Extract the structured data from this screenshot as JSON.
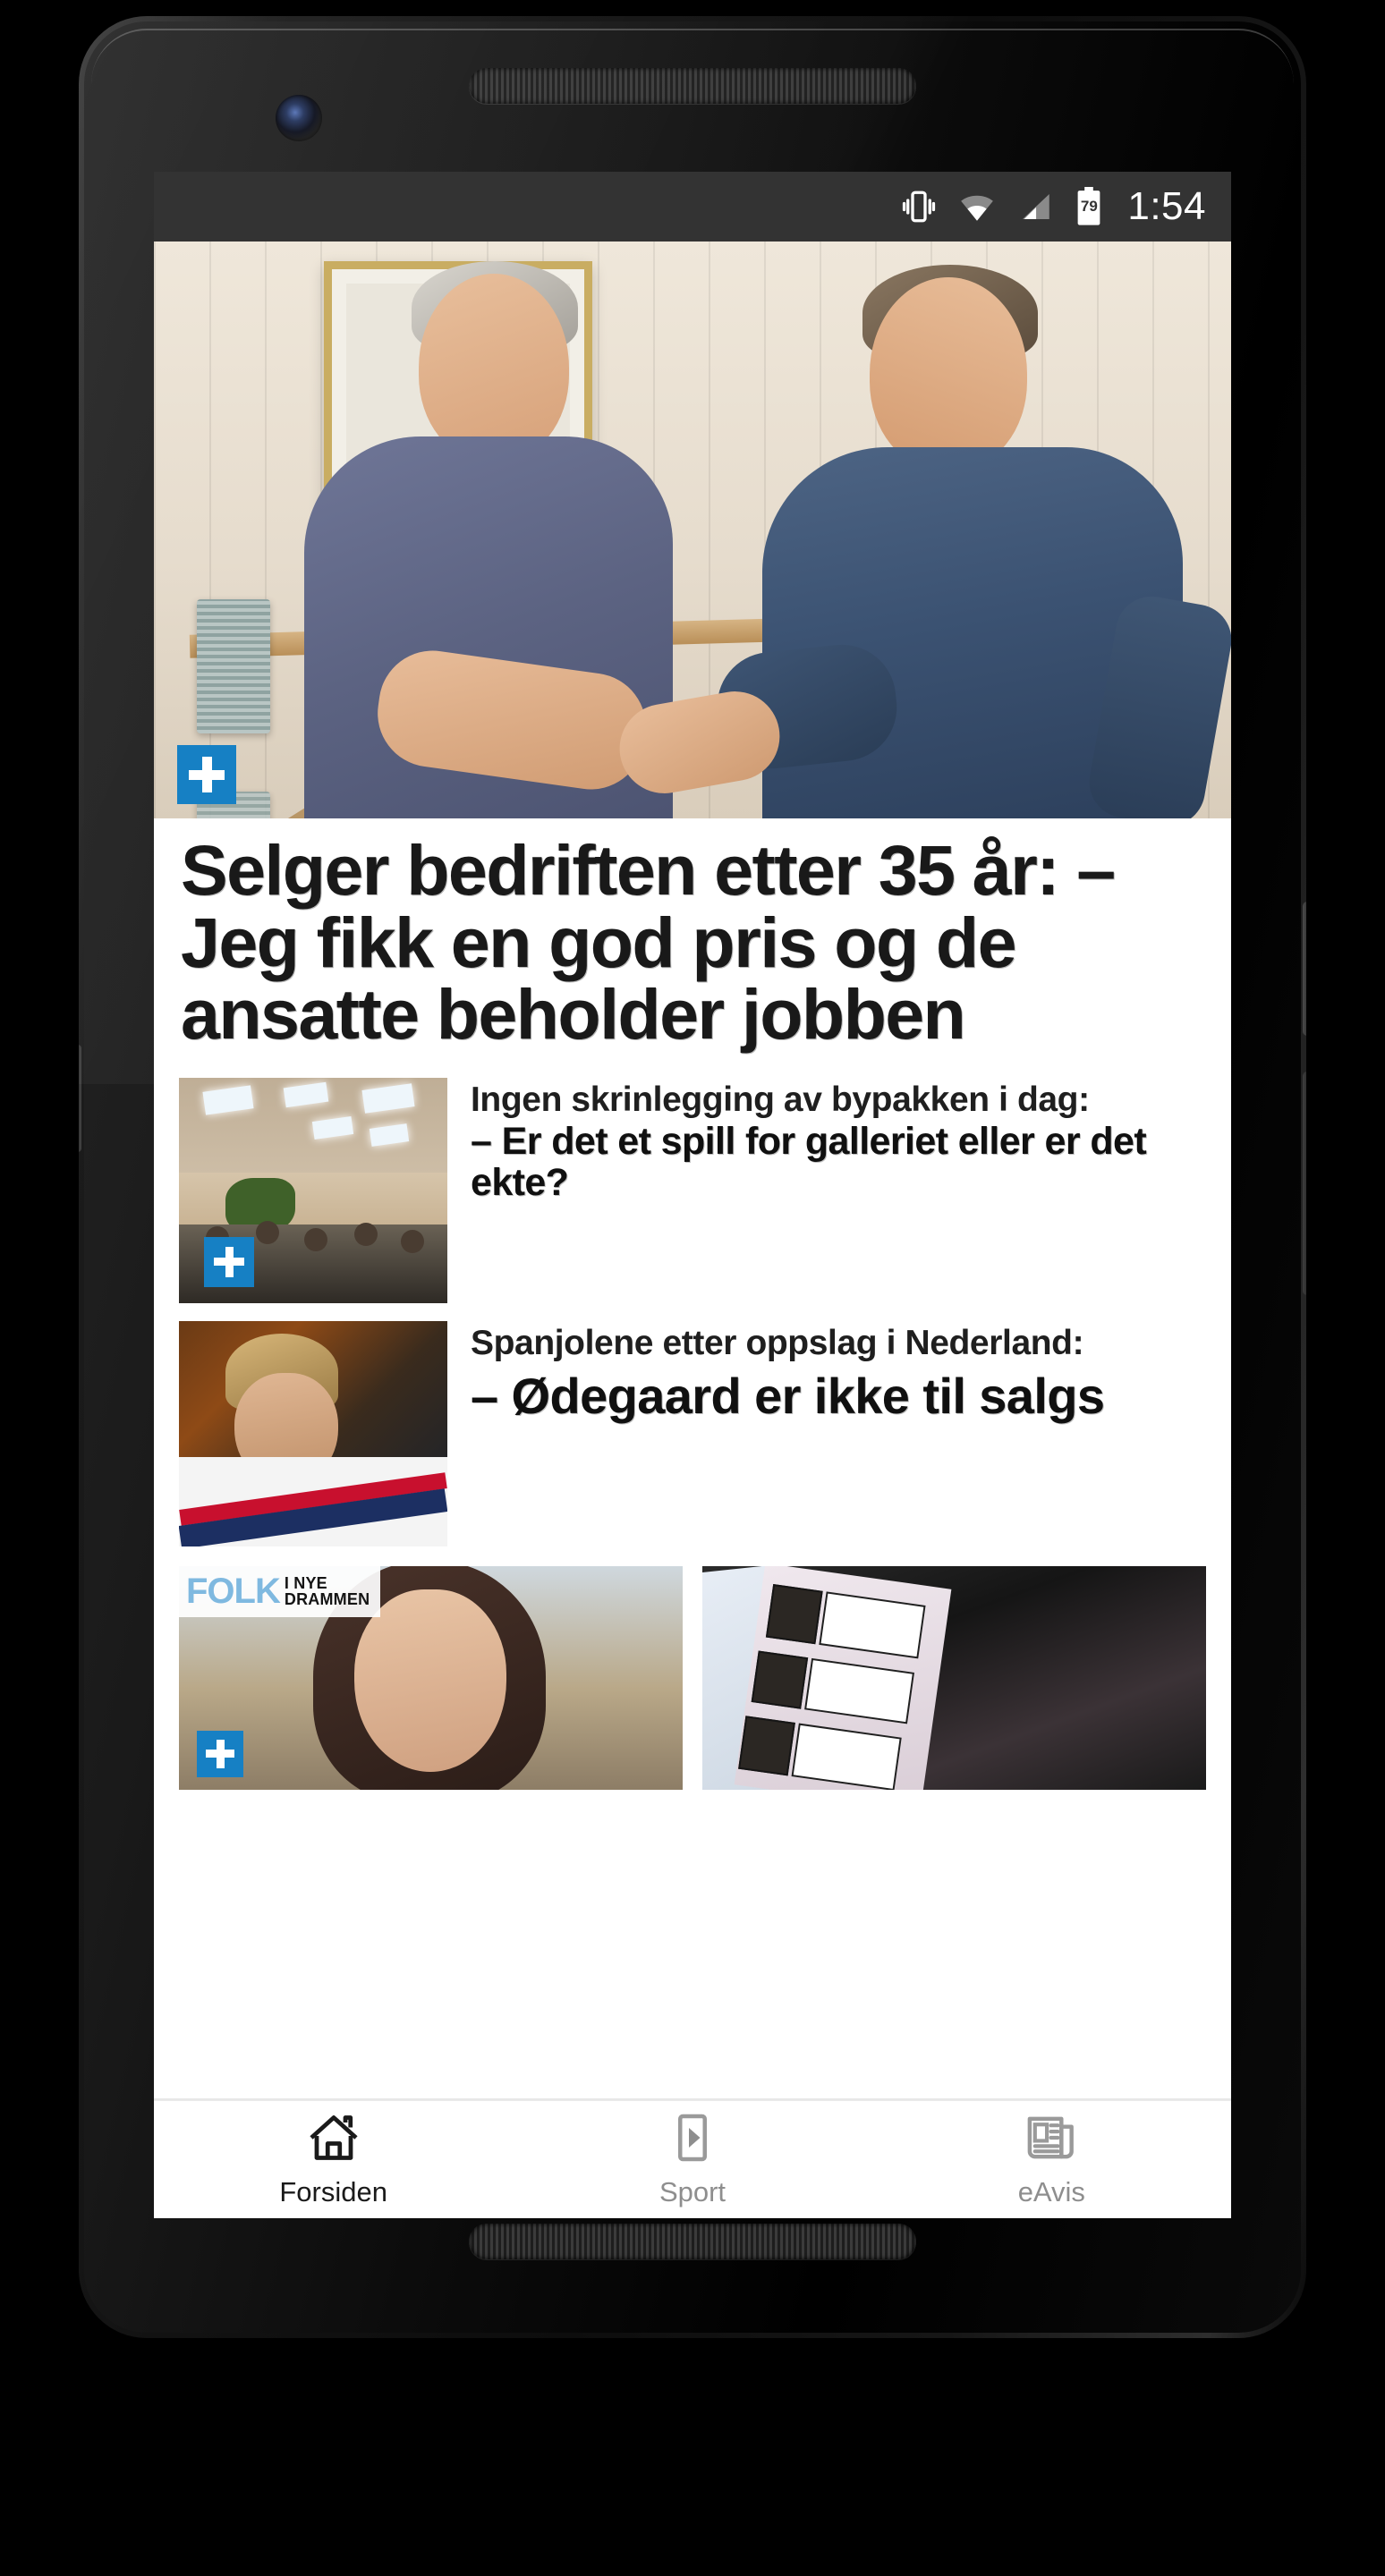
{
  "status_bar": {
    "time": "1:54",
    "battery_percent": "79",
    "icons": [
      "vibrate-icon",
      "wifi-icon",
      "signal-icon",
      "battery-icon"
    ]
  },
  "theme": {
    "plus_badge_blue": "#1680c4",
    "status_bar_bg": "#333333",
    "nav_active_color": "#1a1a1a",
    "nav_inactive_color": "#8e8e8e",
    "folk_brand_blue": "#7fb9e0"
  },
  "feed": {
    "hero": {
      "plus_badge": "+",
      "headline": "Selger bedriften etter 35 år: – Jeg fikk en god pris og de ansatte beholder jobben",
      "image_alt": "to menn håndhilser"
    },
    "articles": [
      {
        "kicker": "Ingen skrinlegging av bypakken i dag:",
        "title": "– Er det et spill for galleriet eller er det ekte?",
        "plus_badge": "+",
        "image_alt": "kommunestyresal"
      },
      {
        "kicker": "Spanjolene etter oppslag i Nederland:",
        "title": "– Ødegaard er ikke til salgs",
        "plus_badge": "",
        "image_alt": "fotballspiller"
      }
    ],
    "cards": [
      {
        "brand_word": "FOLK",
        "brand_sub_line1": "I NYE",
        "brand_sub_line2": "DRAMMEN",
        "plus_badge": "+",
        "image_alt": "portrett av kvinne"
      },
      {
        "plus_badge": "",
        "image_alt": "dokument med bilder"
      }
    ]
  },
  "bottom_nav": {
    "items": [
      {
        "label": "Forsiden",
        "icon": "home-icon",
        "active": true
      },
      {
        "label": "Sport",
        "icon": "play-icon",
        "active": false
      },
      {
        "label": "eAvis",
        "icon": "newspaper-icon",
        "active": false
      }
    ]
  }
}
